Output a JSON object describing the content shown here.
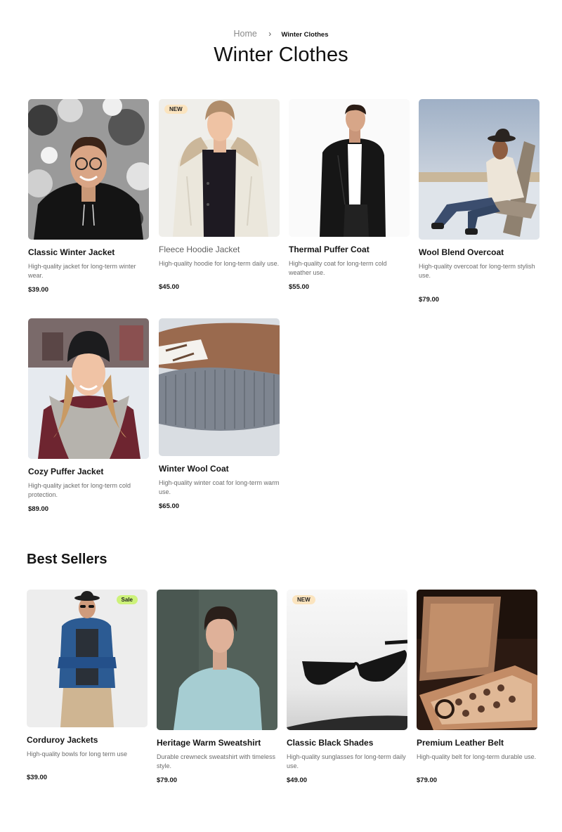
{
  "breadcrumb": {
    "home": "Home",
    "separator": "›",
    "current": "Winter Clothes"
  },
  "page_title": "Winter Clothes",
  "winter_products": [
    {
      "name": "Classic Winter Jacket",
      "desc": "High-quality jacket for long-term winter wear.",
      "price": "$39.00",
      "badge": ""
    },
    {
      "name": "Fleece Hoodie Jacket",
      "desc": "High-quality hoodie for long-term daily use.",
      "price": "$45.00",
      "badge": "NEW"
    },
    {
      "name": "Thermal Puffer Coat",
      "desc": "High-quality coat for long-term cold weather use.",
      "price": "$55.00",
      "badge": ""
    },
    {
      "name": "Wool Blend Overcoat",
      "desc": "High-quality overcoat for long-term stylish use.",
      "price": "$79.00",
      "badge": ""
    },
    {
      "name": "Cozy Puffer Jacket",
      "desc": "High-quality jacket for long-term cold protection.",
      "price": "$89.00",
      "badge": ""
    },
    {
      "name": "Winter Wool Coat",
      "desc": "High-quality winter coat for long-term warm use.",
      "price": "$65.00",
      "badge": ""
    }
  ],
  "best_sellers": {
    "title": "Best Sellers",
    "products": [
      {
        "name": "Corduroy Jackets",
        "desc": "High-quality bowls for long term use",
        "price": "$39.00",
        "badge": "Sale"
      },
      {
        "name": "Heritage Warm Sweatshirt",
        "desc": "Durable crewneck sweatshirt with timeless style.",
        "price": "$79.00",
        "badge": ""
      },
      {
        "name": "Classic Black Shades",
        "desc": "High-quality sunglasses for long-term daily use.",
        "price": "$49.00",
        "badge": "NEW"
      },
      {
        "name": "Premium Leather Belt",
        "desc": "High-quality belt for long-term durable use.",
        "price": "$79.00",
        "badge": ""
      }
    ]
  },
  "colors": {
    "badge_new": "#fbe4bf",
    "badge_sale": "#cdf27a",
    "text": "#151515",
    "muted": "#6c6c6c"
  }
}
